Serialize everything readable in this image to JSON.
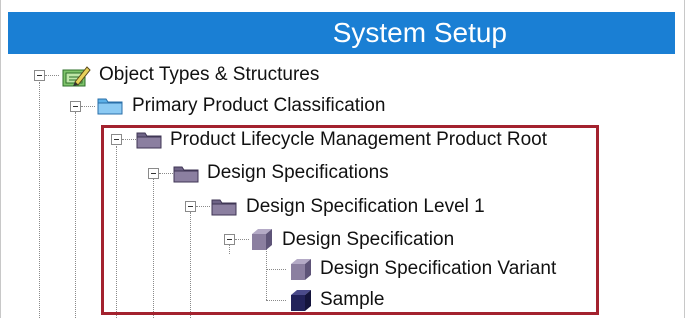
{
  "header": {
    "title": "System Setup"
  },
  "tree": {
    "nodes": [
      {
        "label": "Object Types & Structures",
        "icon": "object-types-icon"
      },
      {
        "label": "Primary Product Classification",
        "icon": "folder-blue-icon"
      },
      {
        "label": "Product Lifecycle Management Product Root",
        "icon": "folder-purple-icon"
      },
      {
        "label": "Design Specifications",
        "icon": "folder-purple-icon"
      },
      {
        "label": "Design Specification Level 1",
        "icon": "folder-purple-icon"
      },
      {
        "label": "Design Specification",
        "icon": "cube-purple-icon"
      },
      {
        "label": "Design Specification Variant",
        "icon": "cube-purple-icon"
      },
      {
        "label": "Sample",
        "icon": "cube-dark-icon"
      }
    ]
  },
  "colors": {
    "header_bg": "#1a7fd4",
    "highlight_border": "#a3222e",
    "folder_purple": "#8b7fa0",
    "folder_blue": "#5cb0e8"
  }
}
